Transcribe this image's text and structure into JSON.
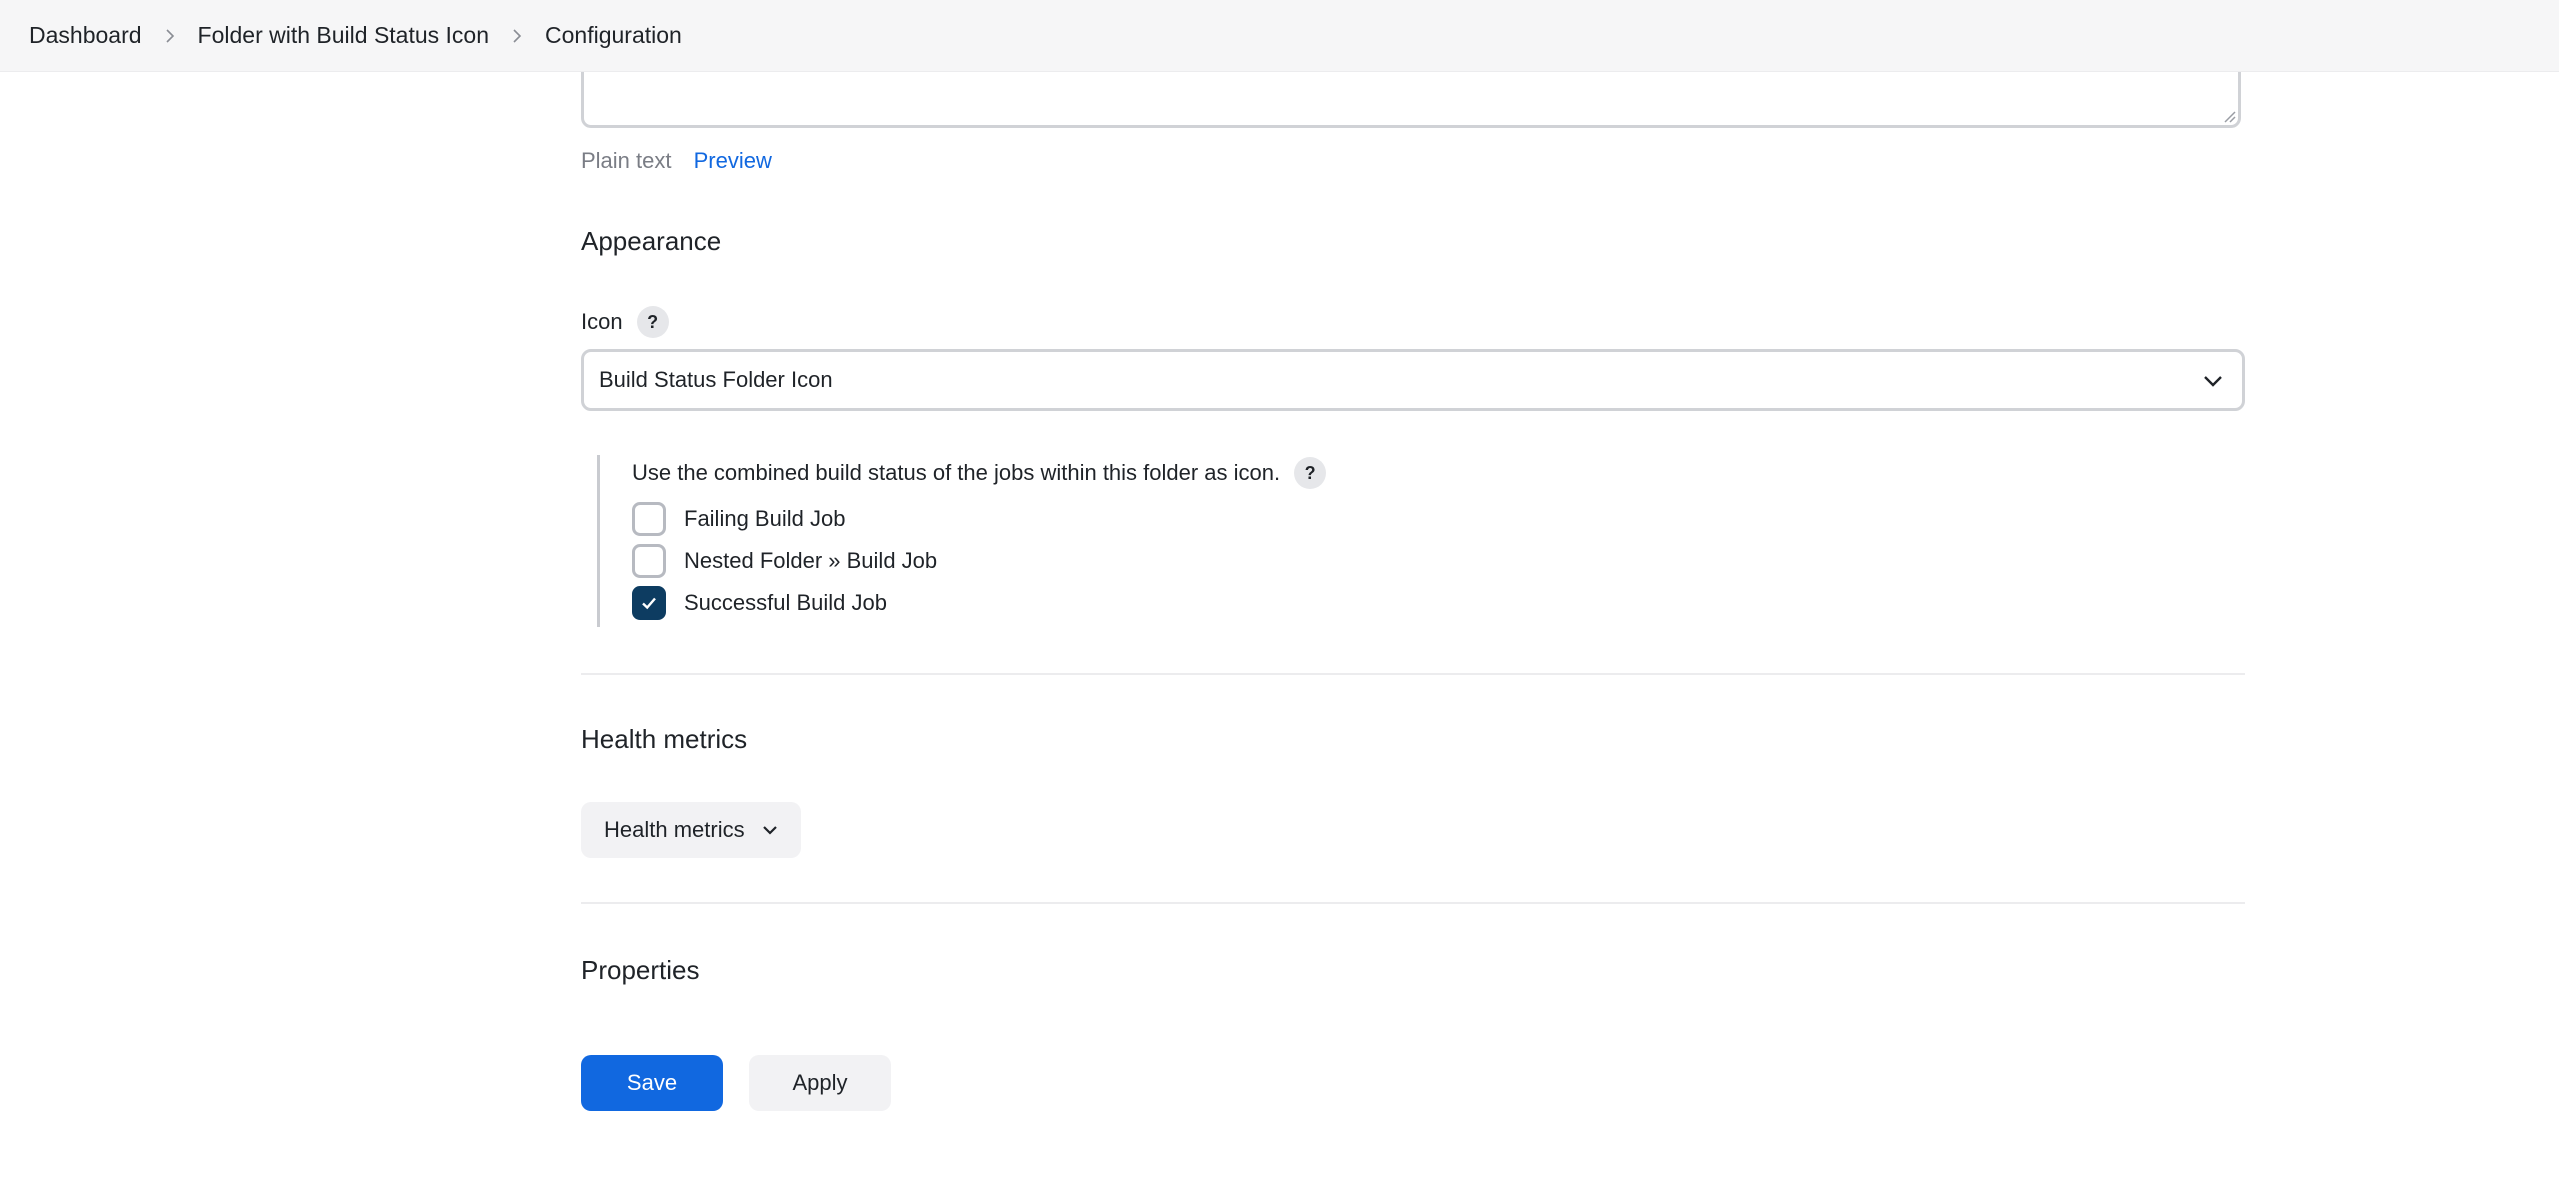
{
  "breadcrumb": {
    "items": [
      "Dashboard",
      "Folder with Build Status Icon",
      "Configuration"
    ]
  },
  "description": {
    "format_plain": "Plain text",
    "format_preview": "Preview"
  },
  "appearance": {
    "title": "Appearance",
    "icon_label": "Icon",
    "help_glyph": "?",
    "icon_selected": "Build Status Folder Icon",
    "status_description": "Use the combined build status of the jobs within this folder as icon.",
    "jobs": [
      {
        "label": "Failing Build Job",
        "checked": false
      },
      {
        "label": "Nested Folder » Build Job",
        "checked": false
      },
      {
        "label": "Successful Build Job",
        "checked": true
      }
    ]
  },
  "health": {
    "title": "Health metrics",
    "button_label": "Health metrics"
  },
  "properties": {
    "title": "Properties"
  },
  "actions": {
    "save_label": "Save",
    "apply_label": "Apply"
  },
  "colors": {
    "primary": "#1168e0",
    "checked": "#0d3c61",
    "breadcrumb_bg": "#f6f6f7"
  },
  "icons": {
    "breadcrumb_separator": "chevron-right-icon",
    "select": "chevron-down-icon",
    "checkbox_checked": "check-icon",
    "help": "help-icon"
  }
}
